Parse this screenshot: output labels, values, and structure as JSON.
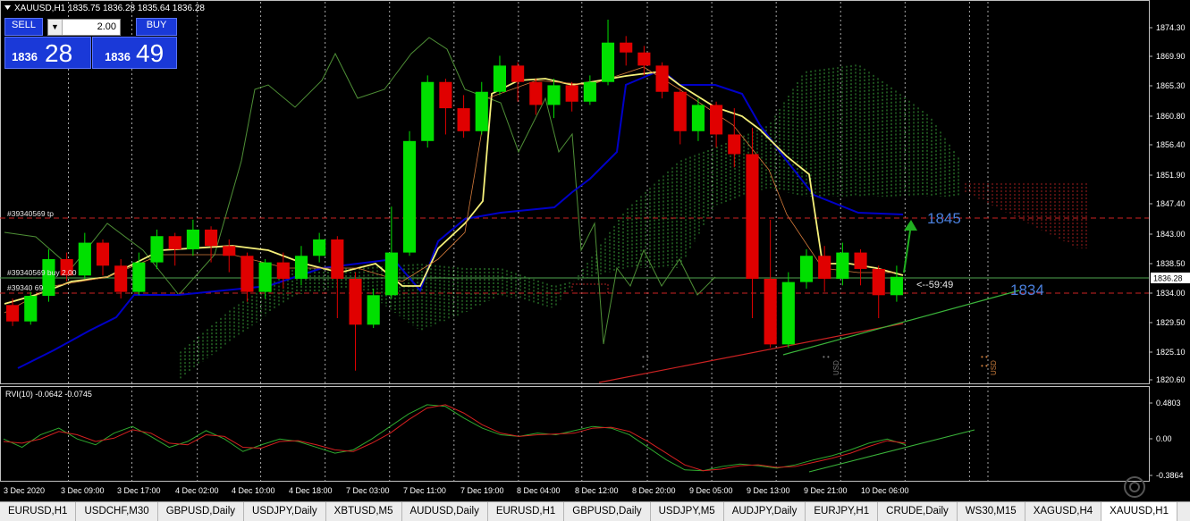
{
  "symbol_header": "XAUUSD,H1  1835.75 1836.28 1835.64 1836.28",
  "trade_panel": {
    "sell_label": "SELL",
    "buy_label": "BUY",
    "lot_value": "2.00",
    "sell_small": "1836",
    "sell_big": "28",
    "buy_small": "1836",
    "buy_big": "49"
  },
  "price_axis": [
    "1874.30",
    "1869.90",
    "1865.30",
    "1860.80",
    "1856.40",
    "1851.90",
    "1847.40",
    "1843.00",
    "1838.50",
    "1834.00",
    "1829.50",
    "1825.10",
    "1820.60"
  ],
  "current_price": "1836.28",
  "order_labels": {
    "tp": "#39340569 tp",
    "buy": "#39340569 buy 2.00",
    "sl": "#39340 69"
  },
  "annotations": {
    "level_1845": "1845",
    "level_1834": "1834",
    "timer": "<--59:49",
    "usd_marker": "USD"
  },
  "indicator": {
    "label": "RVI(10) -0.0642 -0.0745",
    "axis": [
      "0.4803",
      "0.00",
      "-0.3864"
    ]
  },
  "time_axis": [
    "3 Dec 2020",
    "3 Dec 09:00",
    "3 Dec 17:00",
    "4 Dec 02:00",
    "4 Dec 10:00",
    "4 Dec 18:00",
    "7 Dec 03:00",
    "7 Dec 11:00",
    "7 Dec 19:00",
    "8 Dec 04:00",
    "8 Dec 12:00",
    "8 Dec 20:00",
    "9 Dec 05:00",
    "9 Dec 13:00",
    "9 Dec 21:00",
    "10 Dec 06:00"
  ],
  "tabs": [
    {
      "label": "EURUSD,H1",
      "active": false
    },
    {
      "label": "USDCHF,M30",
      "active": false
    },
    {
      "label": "GBPUSD,Daily",
      "active": false
    },
    {
      "label": "USDJPY,Daily",
      "active": false
    },
    {
      "label": "XBTUSD,M5",
      "active": false
    },
    {
      "label": "AUDUSD,Daily",
      "active": false
    },
    {
      "label": "EURUSD,H1",
      "active": false
    },
    {
      "label": "GBPUSD,Daily",
      "active": false
    },
    {
      "label": "USDJPY,M5",
      "active": false
    },
    {
      "label": "AUDJPY,Daily",
      "active": false
    },
    {
      "label": "EURJPY,H1",
      "active": false
    },
    {
      "label": "CRUDE,Daily",
      "active": false
    },
    {
      "label": "WS30,M15",
      "active": false
    },
    {
      "label": "XAGUSD,H4",
      "active": false
    },
    {
      "label": "XAUUSD,H1",
      "active": true
    }
  ],
  "colors": {
    "bull": "#00e000",
    "bear": "#e00000",
    "kijun": "#0000c8",
    "tenkan": "#f5f07a",
    "chikou": "#4e8f36",
    "cloud_bull": "#3fae3f",
    "cloud_bear": "#b02222",
    "trend": "#3ab33a",
    "label_blue": "#4a7fdc"
  },
  "chart_data": {
    "type": "candlestick",
    "symbol": "XAUUSD",
    "timeframe": "H1",
    "ylim": [
      1820.6,
      1875.5
    ],
    "key_levels": [
      1845,
      1834
    ],
    "current_price": 1836.28,
    "candles": [
      {
        "o": 1832.0,
        "c": 1829.5,
        "h": 1833.0,
        "l": 1828.8
      },
      {
        "o": 1829.5,
        "c": 1833.4,
        "h": 1834.0,
        "l": 1829.0
      },
      {
        "o": 1833.4,
        "c": 1839.0,
        "h": 1840.5,
        "l": 1832.5
      },
      {
        "o": 1839.0,
        "c": 1836.5,
        "h": 1840.0,
        "l": 1835.6
      },
      {
        "o": 1836.5,
        "c": 1841.5,
        "h": 1843.0,
        "l": 1836.0
      },
      {
        "o": 1841.5,
        "c": 1838.0,
        "h": 1842.0,
        "l": 1836.5
      },
      {
        "o": 1838.0,
        "c": 1834.0,
        "h": 1839.0,
        "l": 1833.0
      },
      {
        "o": 1834.0,
        "c": 1838.5,
        "h": 1840.0,
        "l": 1833.5
      },
      {
        "o": 1838.5,
        "c": 1842.5,
        "h": 1843.5,
        "l": 1837.5
      },
      {
        "o": 1842.5,
        "c": 1840.5,
        "h": 1843.0,
        "l": 1838.0
      },
      {
        "o": 1840.5,
        "c": 1843.5,
        "h": 1845.0,
        "l": 1839.5
      },
      {
        "o": 1843.5,
        "c": 1841.0,
        "h": 1844.0,
        "l": 1838.5
      },
      {
        "o": 1841.0,
        "c": 1839.5,
        "h": 1842.0,
        "l": 1837.0
      },
      {
        "o": 1839.5,
        "c": 1834.0,
        "h": 1840.0,
        "l": 1832.5
      },
      {
        "o": 1834.0,
        "c": 1838.5,
        "h": 1839.0,
        "l": 1833.0
      },
      {
        "o": 1838.5,
        "c": 1836.0,
        "h": 1840.0,
        "l": 1834.5
      },
      {
        "o": 1836.0,
        "c": 1839.5,
        "h": 1841.0,
        "l": 1835.0
      },
      {
        "o": 1839.5,
        "c": 1842.0,
        "h": 1843.0,
        "l": 1838.5
      },
      {
        "o": 1842.0,
        "c": 1836.0,
        "h": 1842.5,
        "l": 1830.0
      },
      {
        "o": 1836.0,
        "c": 1829.0,
        "h": 1837.0,
        "l": 1822.0
      },
      {
        "o": 1829.0,
        "c": 1833.5,
        "h": 1834.5,
        "l": 1828.5
      },
      {
        "o": 1833.5,
        "c": 1840.0,
        "h": 1847.0,
        "l": 1833.0
      },
      {
        "o": 1840.0,
        "c": 1857.0,
        "h": 1858.5,
        "l": 1839.5
      },
      {
        "o": 1857.0,
        "c": 1866.0,
        "h": 1867.0,
        "l": 1856.0
      },
      {
        "o": 1866.0,
        "c": 1862.0,
        "h": 1866.5,
        "l": 1858.0
      },
      {
        "o": 1862.0,
        "c": 1858.5,
        "h": 1864.0,
        "l": 1857.5
      },
      {
        "o": 1858.5,
        "c": 1864.5,
        "h": 1866.0,
        "l": 1858.0
      },
      {
        "o": 1864.5,
        "c": 1868.5,
        "h": 1870.0,
        "l": 1864.0
      },
      {
        "o": 1868.5,
        "c": 1866.0,
        "h": 1869.0,
        "l": 1863.0
      },
      {
        "o": 1866.0,
        "c": 1862.5,
        "h": 1866.5,
        "l": 1861.0
      },
      {
        "o": 1862.5,
        "c": 1865.5,
        "h": 1866.5,
        "l": 1860.5
      },
      {
        "o": 1865.5,
        "c": 1863.0,
        "h": 1866.0,
        "l": 1861.5
      },
      {
        "o": 1863.0,
        "c": 1866.0,
        "h": 1867.0,
        "l": 1862.5
      },
      {
        "o": 1866.0,
        "c": 1872.0,
        "h": 1875.5,
        "l": 1865.5
      },
      {
        "o": 1872.0,
        "c": 1870.5,
        "h": 1873.0,
        "l": 1868.5
      },
      {
        "o": 1870.5,
        "c": 1868.5,
        "h": 1871.5,
        "l": 1867.0
      },
      {
        "o": 1868.5,
        "c": 1864.5,
        "h": 1869.0,
        "l": 1863.5
      },
      {
        "o": 1864.5,
        "c": 1858.5,
        "h": 1865.0,
        "l": 1856.5
      },
      {
        "o": 1858.5,
        "c": 1862.5,
        "h": 1863.5,
        "l": 1857.0
      },
      {
        "o": 1862.5,
        "c": 1858.0,
        "h": 1863.0,
        "l": 1856.0
      },
      {
        "o": 1858.0,
        "c": 1855.0,
        "h": 1862.0,
        "l": 1853.0
      },
      {
        "o": 1855.0,
        "c": 1836.0,
        "h": 1859.0,
        "l": 1830.0
      },
      {
        "o": 1836.0,
        "c": 1826.0,
        "h": 1845.0,
        "l": 1825.5
      },
      {
        "o": 1826.0,
        "c": 1835.5,
        "h": 1837.0,
        "l": 1825.5
      },
      {
        "o": 1835.5,
        "c": 1839.5,
        "h": 1840.5,
        "l": 1834.5
      },
      {
        "o": 1839.5,
        "c": 1836.0,
        "h": 1841.0,
        "l": 1834.0
      },
      {
        "o": 1836.0,
        "c": 1840.0,
        "h": 1841.5,
        "l": 1835.0
      },
      {
        "o": 1840.0,
        "c": 1837.5,
        "h": 1840.5,
        "l": 1835.0
      },
      {
        "o": 1837.5,
        "c": 1833.5,
        "h": 1838.0,
        "l": 1830.0
      },
      {
        "o": 1833.5,
        "c": 1836.3,
        "h": 1838.0,
        "l": 1832.5
      }
    ],
    "rvi": {
      "ylim": [
        -0.3864,
        0.4803
      ],
      "main": [
        0.05,
        -0.05,
        0.1,
        0.18,
        0.05,
        -0.02,
        0.12,
        0.2,
        0.08,
        -0.05,
        0.02,
        0.15,
        0.05,
        -0.1,
        -0.02,
        0.05,
        0.02,
        -0.05,
        -0.12,
        -0.08,
        0.05,
        0.2,
        0.35,
        0.46,
        0.44,
        0.3,
        0.18,
        0.1,
        0.08,
        0.12,
        0.1,
        0.15,
        0.2,
        0.18,
        0.1,
        -0.05,
        -0.2,
        -0.32,
        -0.33,
        -0.28,
        -0.25,
        -0.27,
        -0.3,
        -0.26,
        -0.2,
        -0.15,
        -0.08,
        0.0,
        0.05,
        -0.02
      ],
      "signal": [
        0.02,
        0.0,
        0.05,
        0.14,
        0.1,
        0.02,
        0.06,
        0.16,
        0.12,
        0.0,
        -0.02,
        0.1,
        0.08,
        -0.05,
        -0.06,
        0.02,
        0.03,
        -0.02,
        -0.08,
        -0.1,
        0.0,
        0.12,
        0.28,
        0.42,
        0.46,
        0.36,
        0.22,
        0.12,
        0.08,
        0.1,
        0.11,
        0.12,
        0.18,
        0.19,
        0.14,
        0.02,
        -0.12,
        -0.26,
        -0.33,
        -0.31,
        -0.27,
        -0.26,
        -0.29,
        -0.28,
        -0.23,
        -0.18,
        -0.12,
        -0.04,
        0.03,
        0.0
      ]
    }
  }
}
